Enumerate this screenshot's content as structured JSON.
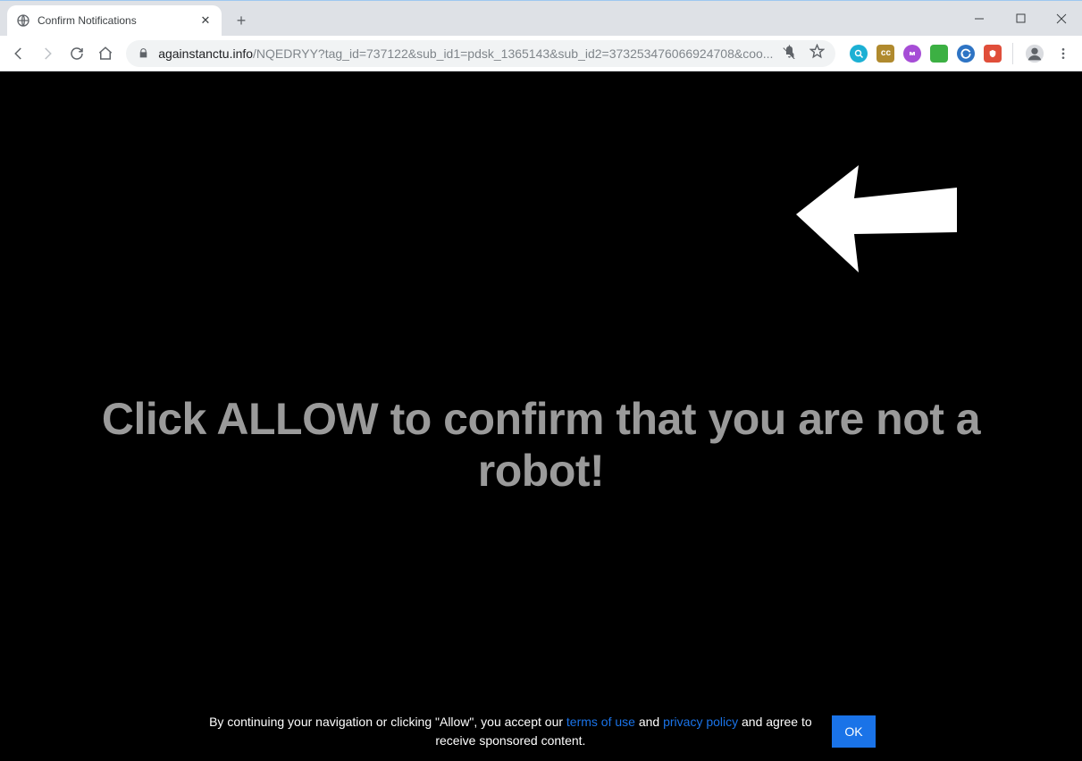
{
  "tab": {
    "title": "Confirm Notifications"
  },
  "toolbar": {
    "url_host": "againstanctu.info",
    "url_path": "/NQEDRYY?tag_id=737122&sub_id1=pdsk_1365143&sub_id2=373253476066924708&coo..."
  },
  "extensions": {
    "ext1_bg": "#1cb0d4",
    "ext2_bg": "#b08a2e",
    "ext2_label": "cc",
    "ext3_bg": "#a64dd6",
    "ext4_bg": "#3cb043",
    "ext5_bg": "#2e74c4",
    "ext6_bg": "#e04e3a"
  },
  "page": {
    "headline": "Click ALLOW to confirm that you are not a robot!",
    "footer_prefix": "By continuing your navigation or clicking \"Allow\", you accept our ",
    "terms_label": "terms of use",
    "footer_mid": " and ",
    "privacy_label": "privacy policy",
    "footer_suffix": " and agree to receive sponsored content.",
    "ok_label": "OK"
  }
}
